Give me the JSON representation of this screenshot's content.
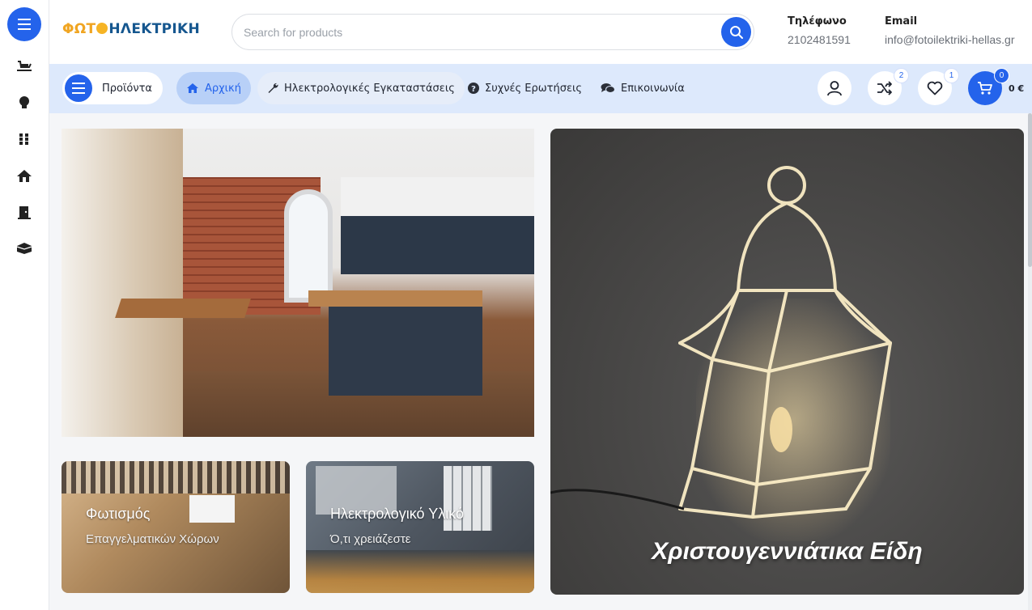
{
  "logo": {
    "part_a": "ΦΩΤ",
    "part_b": "ΗΛΕΚΤΡΙΚΗ"
  },
  "search": {
    "placeholder": "Search for products"
  },
  "contact": {
    "phone_label": "Τηλέφωνο",
    "phone_value": "2102481591",
    "email_label": "Email",
    "email_value": "info@fotoilektriki-hellas.gr"
  },
  "rail": {
    "icons": [
      "menu-icon",
      "sleigh-icon",
      "lightbulb-icon",
      "grid-icon",
      "house-icon",
      "door-icon",
      "box-icon"
    ]
  },
  "nav": {
    "products_label": "Προϊόντα",
    "items": [
      {
        "label": "Αρχική",
        "icon": "home-icon",
        "active": true
      },
      {
        "label": "Ηλεκτρολογικές Εγκαταστάσεις",
        "icon": "wrench-icon"
      },
      {
        "label": "Συχνές Ερωτήσεις",
        "icon": "question-icon"
      },
      {
        "label": "Επικοινωνία",
        "icon": "chat-icon"
      }
    ]
  },
  "actions": {
    "compare_count": "2",
    "wishlist_count": "1",
    "cart_count": "0",
    "cart_total": "0 €"
  },
  "banners": {
    "office_title": "Φωτισμός",
    "office_subtitle": "Επαγγελματικών Χώρων",
    "electrical_title": "Ηλεκτρολογικό Υλικό",
    "electrical_subtitle": "Ό,τι χρειάζεστε",
    "xmas_title": "Χριστουγεννιάτικα Είδη"
  },
  "colors": {
    "accent": "#2463eb",
    "nav_bg": "#dde9fc",
    "logo_orange": "#f0a522",
    "logo_blue": "#16578f"
  }
}
